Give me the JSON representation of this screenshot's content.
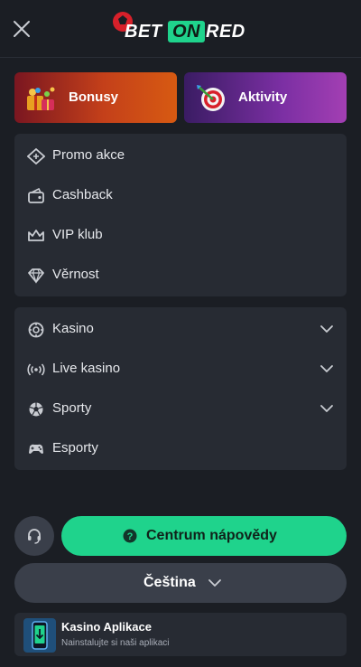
{
  "header": {
    "close_icon": "close-icon",
    "logo": {
      "part1": "BET",
      "part2": "ON",
      "part3": "RED"
    }
  },
  "promos": {
    "bonus_label": "Bonusy",
    "bonus_icon": "gift-boxes-icon",
    "activity_label": "Aktivity",
    "activity_icon": "dart-target-icon"
  },
  "menu_primary": {
    "items": [
      {
        "label": "Promo akce",
        "icon": "promo-ticket-icon"
      },
      {
        "label": "Cashback",
        "icon": "cashback-wallet-icon"
      },
      {
        "label": "VIP klub",
        "icon": "crown-icon"
      },
      {
        "label": "Věrnost",
        "icon": "diamond-icon"
      }
    ]
  },
  "menu_secondary": {
    "items": [
      {
        "label": "Kasino",
        "icon": "casino-chip-icon",
        "has_submenu": true
      },
      {
        "label": "Live kasino",
        "icon": "live-broadcast-icon",
        "has_submenu": true
      },
      {
        "label": "Sporty",
        "icon": "soccer-ball-icon",
        "has_submenu": true
      },
      {
        "label": "Esporty",
        "icon": "gamepad-icon",
        "has_submenu": false
      }
    ]
  },
  "footer": {
    "support_icon": "headset-icon",
    "help_label": "Centrum nápovědy",
    "help_icon": "question-icon",
    "language_label": "Čeština",
    "app_banner": {
      "title": "Kasino Aplikace",
      "subtitle": "Nainstalujte si naši aplikaci",
      "icon": "phone-app-icon"
    }
  },
  "colors": {
    "background": "#1b1e24",
    "panel": "#272b33",
    "accent_green": "#1fd38c",
    "button_gray": "#3a3f4a"
  }
}
